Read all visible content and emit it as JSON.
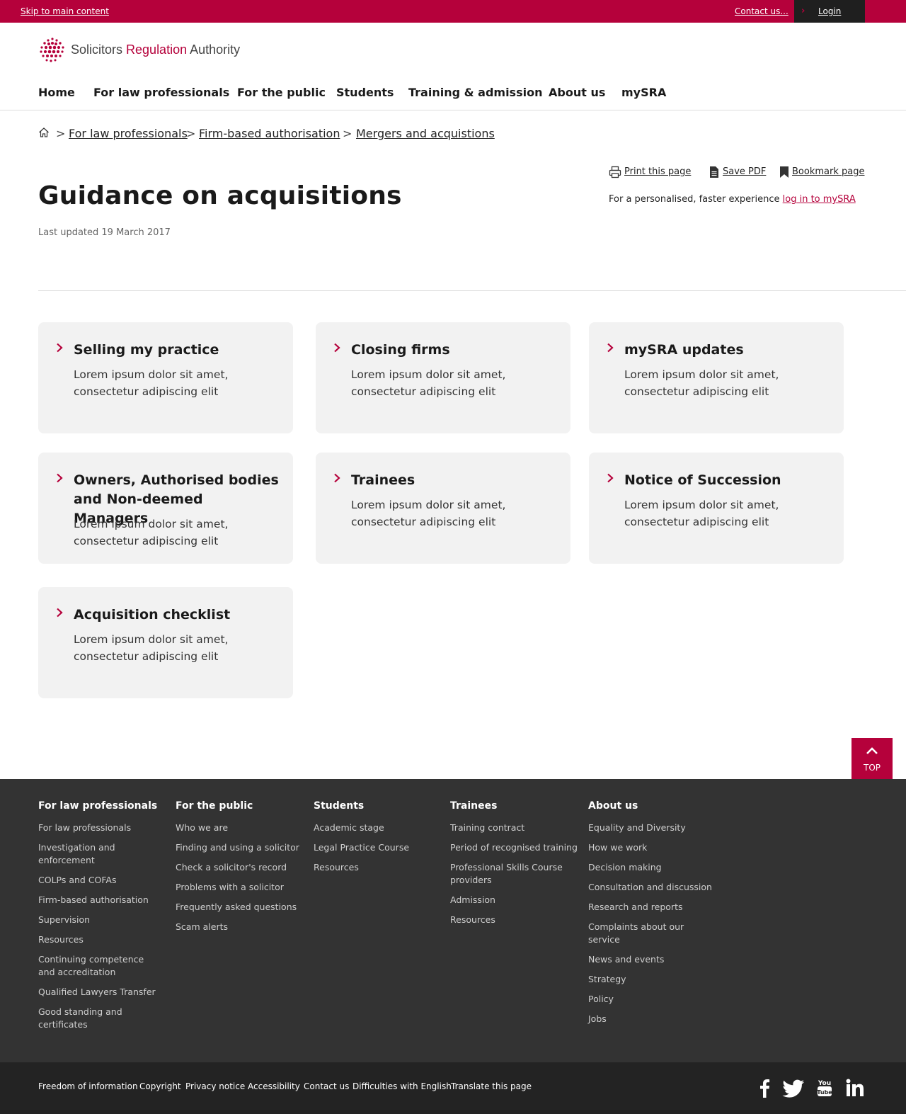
{
  "topbar": {
    "skip_link": "Skip to main content",
    "contact": "Contact us...",
    "login": "Login"
  },
  "brand": {
    "name_part1": "Solicitors ",
    "name_part2": "Regulation",
    "name_part3": " Authority",
    "accent_color": "#b5013b"
  },
  "nav": {
    "items": [
      "Home",
      "For law professionals",
      "For the public",
      "Students",
      "Training & admission",
      "About us",
      "mySRA"
    ]
  },
  "breadcrumb": {
    "items": [
      "For law professionals",
      "Firm-based authorisation",
      "Mergers and acquistions"
    ],
    "separator": ">"
  },
  "tools": {
    "print": "Print this page",
    "save_pdf": "Save PDF",
    "bookmark": "Bookmark page",
    "personal_text": "For a personalised, faster experience ",
    "personal_link": "log in to mySRA"
  },
  "page": {
    "title": "Guidance on acquisitions",
    "updated": "Last updated 19 March 2017"
  },
  "cards": [
    {
      "title": "Selling my practice",
      "desc": "Lorem ipsum dolor sit amet, consectetur adipiscing elit"
    },
    {
      "title": "Closing firms",
      "desc": "Lorem ipsum dolor sit amet, consectetur adipiscing elit"
    },
    {
      "title": "mySRA updates",
      "desc": "Lorem ipsum dolor sit amet, consectetur adipiscing elit"
    },
    {
      "title": "Owners, Authorised bodies and Non-deemed Managers",
      "desc": "Lorem ipsum dolor sit amet, consectetur adipiscing elit"
    },
    {
      "title": "Trainees",
      "desc": "Lorem ipsum dolor sit amet, consectetur adipiscing elit"
    },
    {
      "title": "Notice of Succession",
      "desc": "Lorem ipsum dolor sit amet, consectetur adipiscing elit"
    },
    {
      "title": "Acquisition checklist",
      "desc": "Lorem ipsum dolor sit amet, consectetur adipiscing elit"
    }
  ],
  "back_to_top": "TOP",
  "footer": {
    "columns": [
      {
        "heading": "For law professionals",
        "links": [
          "For law professionals",
          "Investigation and enforcement",
          "COLPs and COFAs",
          "Firm-based authorisation",
          "Supervision",
          "Resources",
          "Continuing competence and accreditation",
          "Qualified Lawyers Transfer",
          "Good standing and certificates"
        ]
      },
      {
        "heading": "For the public",
        "links": [
          "Who we are",
          "Finding and using a solicitor",
          "Check a solicitor's record",
          "Problems with a solicitor",
          "Frequently asked questions",
          "Scam alerts"
        ]
      },
      {
        "heading": "Students",
        "links": [
          "Academic stage",
          "Legal Practice Course",
          "Resources"
        ]
      },
      {
        "heading": "Trainees",
        "links": [
          "Training contract",
          "Period of recognised training",
          "Professional Skills Course providers",
          "Admission",
          "Resources"
        ]
      },
      {
        "heading": "About us",
        "links": [
          "Equality and Diversity",
          "How we work",
          "Decision making",
          "Consultation and discussion",
          "Research and reports",
          "Complaints about our service",
          "News and events",
          "Strategy",
          "Policy",
          "Jobs"
        ]
      }
    ],
    "bottom_links": [
      "Freedom of information",
      "Copyright",
      "Privacy notice",
      "Accessibility",
      "Contact us",
      "Difficulties with English",
      "Translate this page"
    ],
    "social_icons": [
      "facebook-icon",
      "twitter-icon",
      "youtube-icon",
      "linkedin-icon"
    ]
  }
}
